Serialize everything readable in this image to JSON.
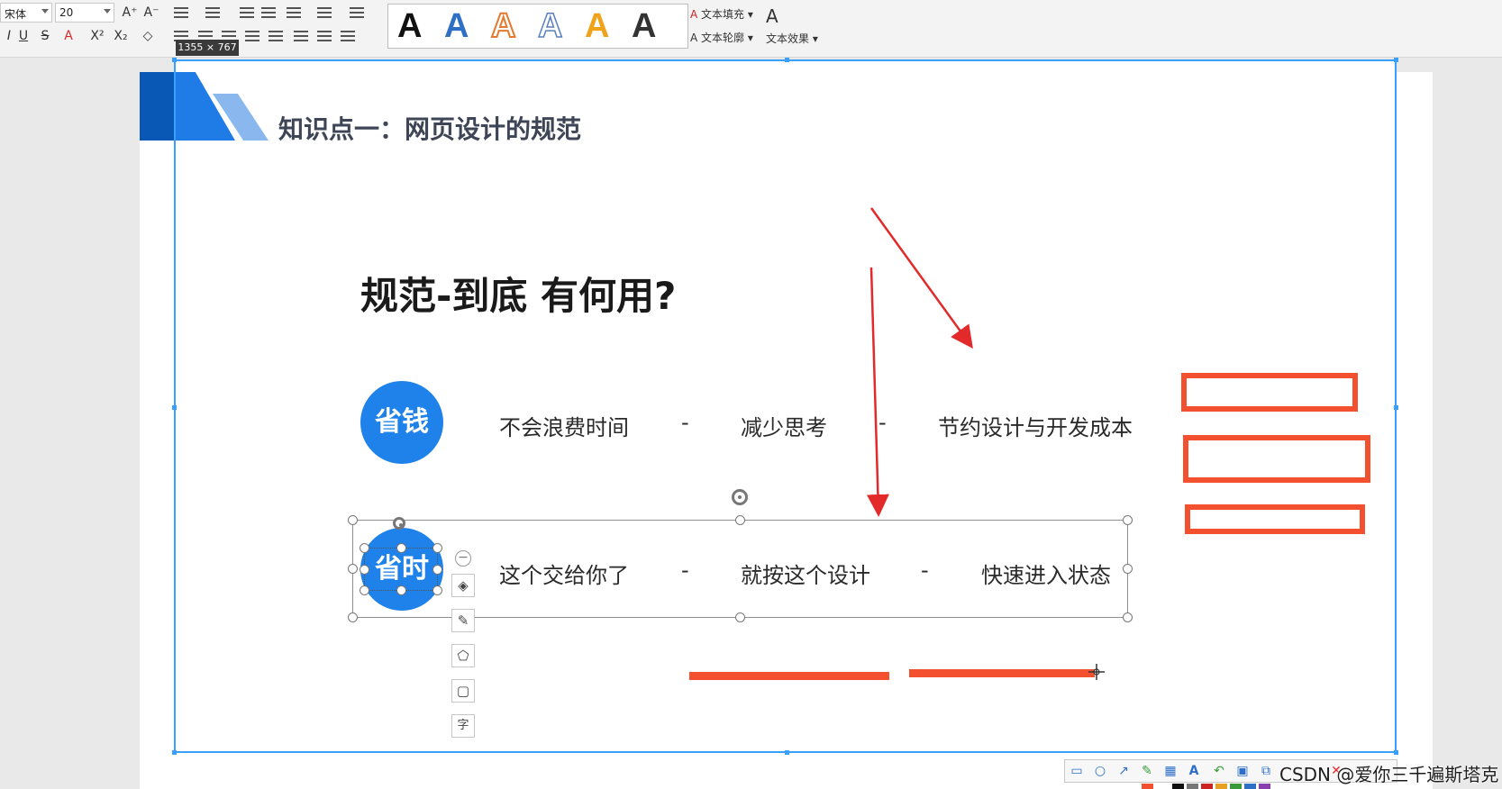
{
  "toolbar": {
    "font_name": "宋体",
    "font_size": "20",
    "size_tooltip": "1355 × 767",
    "text_fill_label": "文本填充",
    "text_outline_label": "文本轮廓",
    "text_effect_label": "文本效果",
    "style_letter": "A",
    "style_colors": [
      "#111111",
      "#2f6fc4",
      "#e27a2f",
      "#5a7fc0",
      "#f0a21b",
      "#333333"
    ]
  },
  "slide": {
    "title": "知识点一：网页设计的规范",
    "heading": "规范-到底 有何用?",
    "rows": [
      {
        "badge": "省钱",
        "items": [
          "不会浪费时间",
          "-",
          "减少思考",
          "-",
          "节约设计与开发成本"
        ]
      },
      {
        "badge": "省时",
        "items": [
          "这个交给你了",
          "-",
          "就按这个设计",
          "-",
          "快速进入状态"
        ]
      }
    ]
  },
  "float_toolbar": {
    "collapse_symbol": "−",
    "layers_symbol": "◈",
    "brush_symbol": "✎",
    "fill_symbol": "⬠",
    "border_symbol": "▢",
    "text_symbol": "字"
  },
  "annotation_toolbar": {
    "icons": [
      "rect-icon",
      "ellipse-icon",
      "arrow-icon",
      "pen-icon",
      "mosaic-icon",
      "text-icon",
      "undo-icon",
      "save-icon",
      "copy-icon",
      "cancel-icon"
    ]
  },
  "watermark": "CSDN @爱你三千遍斯塔克",
  "colors": {
    "accent_blue": "#1f82ea",
    "annotation_red": "#f2502f",
    "selection_blue": "#3aa0ff"
  }
}
